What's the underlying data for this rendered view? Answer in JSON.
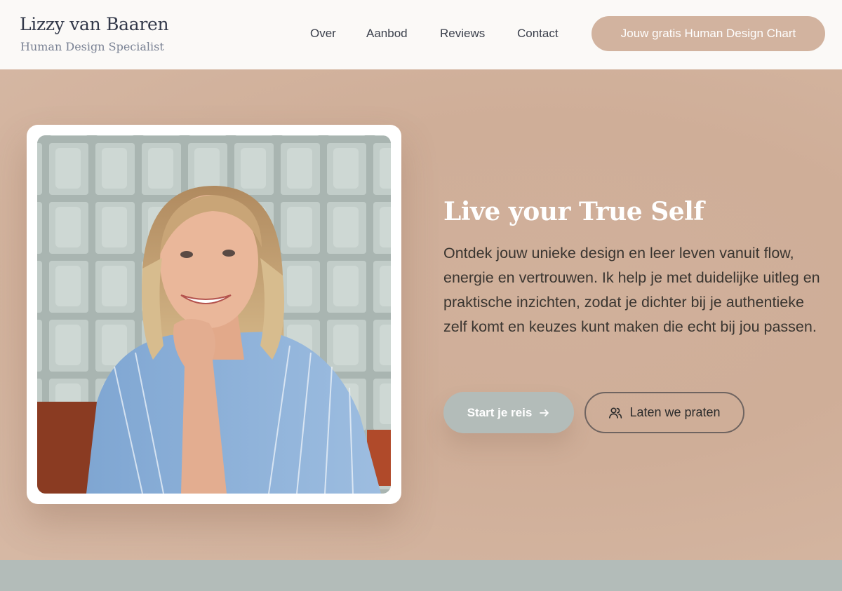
{
  "brand": {
    "name": "Lizzy van Baaren",
    "subtitle": "Human Design Specialist"
  },
  "nav": {
    "items": [
      {
        "label": "Over"
      },
      {
        "label": "Aanbod"
      },
      {
        "label": "Reviews"
      },
      {
        "label": "Contact"
      }
    ],
    "cta_label": "Jouw gratis Human Design Chart"
  },
  "hero": {
    "title": "Live your True Self",
    "text": "Ontdek jouw unieke design en leer leven vanuit flow, energie en vertrouwen. Ik help je met duidelijke uitleg en praktische inzichten, zodat je dichter bij je authentieke zelf komt en keuzes kunt maken die echt bij jou passen.",
    "primary_button": "Start je reis",
    "primary_icon": "arrow-right-icon",
    "secondary_button": "Laten we praten",
    "secondary_icon": "users-icon"
  },
  "colors": {
    "header_bg": "#fbf9f7",
    "accent": "#d2b39f",
    "hero_bg": "#cfae98",
    "sage": "#b3bcb9"
  }
}
